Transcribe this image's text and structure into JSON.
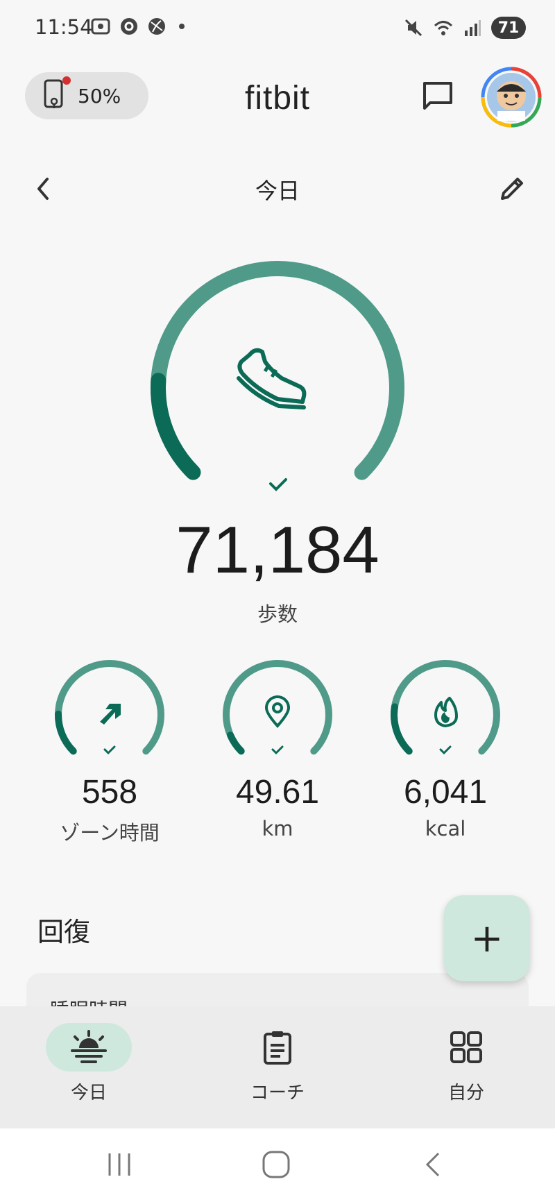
{
  "status_bar": {
    "time": "11:54",
    "battery": "71"
  },
  "header": {
    "device_battery": "50%",
    "logo": "fitbit"
  },
  "day_nav": {
    "title": "今日"
  },
  "main_metric": {
    "value": "71,184",
    "label": "歩数",
    "progress": 0.18
  },
  "metrics": [
    {
      "value": "558",
      "label": "ゾーン時間",
      "icon": "zone-arrow-icon",
      "progress": 0.17
    },
    {
      "value": "49.61",
      "label": "km",
      "icon": "location-pin-icon",
      "progress": 0.08
    },
    {
      "value": "6,041",
      "label": "kcal",
      "icon": "flame-icon",
      "progress": 0.2
    }
  ],
  "recovery": {
    "title": "回復",
    "card_label": "睡眠時間"
  },
  "fab": {
    "label": "+"
  },
  "bottom_nav": [
    {
      "label": "今日",
      "icon": "sunrise-icon",
      "active": true
    },
    {
      "label": "コーチ",
      "icon": "clipboard-icon",
      "active": false
    },
    {
      "label": "自分",
      "icon": "grid-icon",
      "active": false
    }
  ],
  "colors": {
    "ring_light": "#4f9a88",
    "ring_dark": "#0b6b56",
    "fab_bg": "#cfe8de"
  }
}
